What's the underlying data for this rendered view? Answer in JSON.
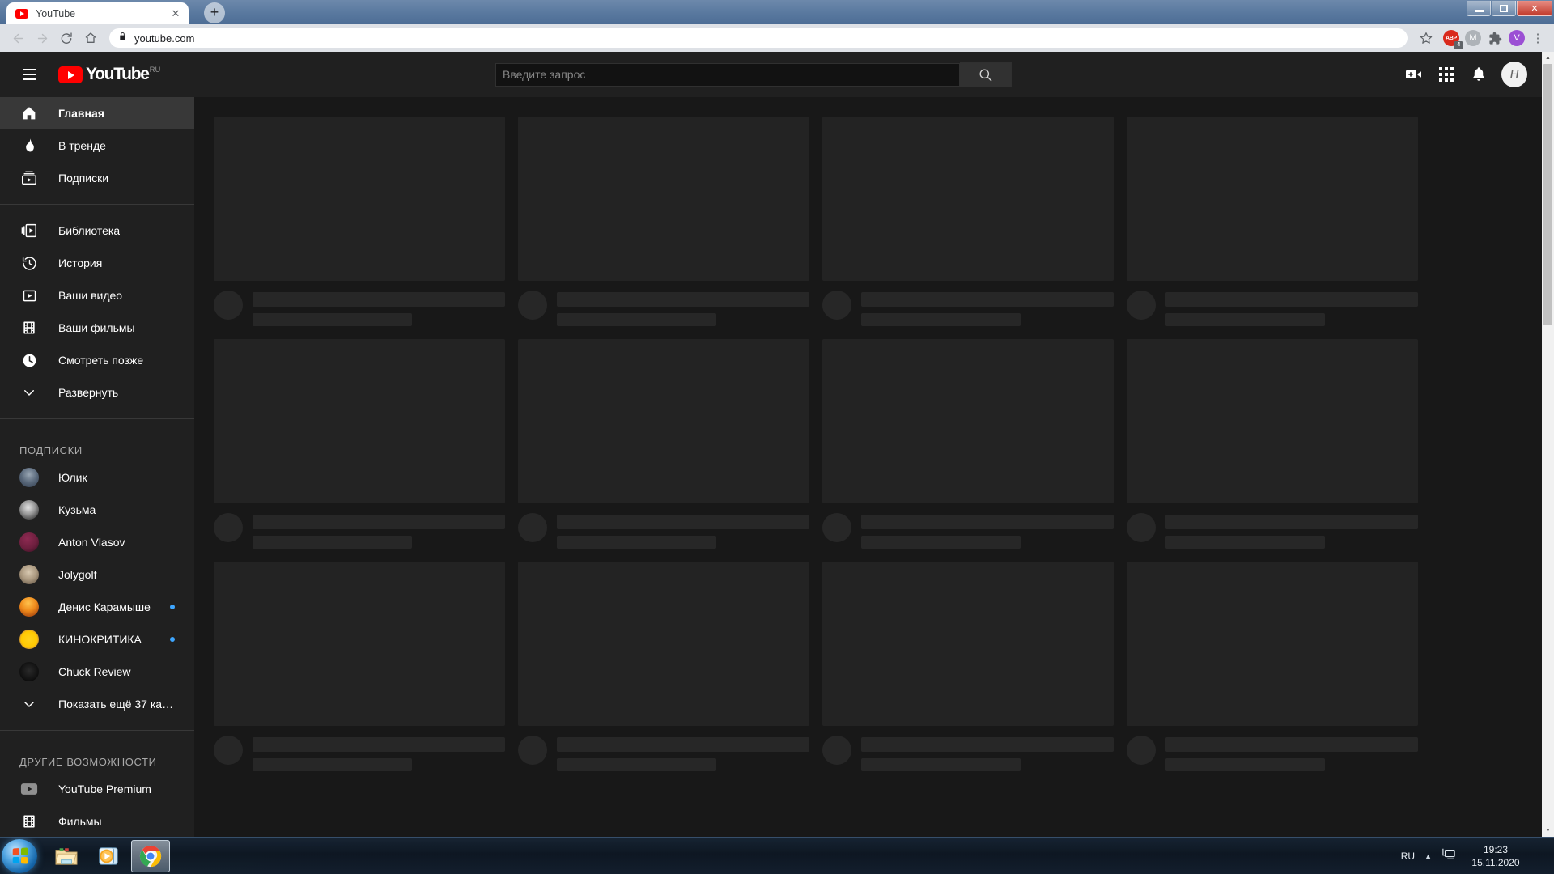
{
  "desktop": {
    "taskbar": {
      "start_label": "start-orb",
      "apps": [
        {
          "name": "explorer",
          "label": "Windows Explorer"
        },
        {
          "name": "media-player",
          "label": "Windows Media Player"
        },
        {
          "name": "chrome",
          "label": "Google Chrome",
          "active": true
        }
      ],
      "tray": {
        "language": "RU",
        "time": "19:23",
        "date": "15.11.2020"
      }
    }
  },
  "browser": {
    "tab": {
      "title": "YouTube",
      "close_label": "✕"
    },
    "new_tab_label": "+",
    "window_controls": {
      "minimize": "minimize",
      "maximize": "maximize",
      "close": "✕"
    },
    "toolbar": {
      "back": "←",
      "forward": "→",
      "reload": "↻",
      "home": "home-icon",
      "url": "youtube.com",
      "lock": "lock-icon",
      "bookmark": "☆",
      "extensions": [
        {
          "name": "adblock-plus",
          "label": "ABP",
          "badge": "4",
          "color": "#d9291c"
        },
        {
          "name": "extension-m",
          "label": "M",
          "color": "#aeb3b8"
        },
        {
          "name": "extensions-puzzle",
          "label": "puzzle",
          "color": "#5f6368"
        },
        {
          "name": "profile-v",
          "label": "V",
          "color": "#9b4fd4"
        }
      ],
      "menu": "⋮"
    }
  },
  "youtube": {
    "masthead": {
      "menu_label": "guide-toggle",
      "logo_word": "YouTube",
      "logo_country": "RU",
      "search_placeholder": "Введите запрос",
      "search_value": "",
      "search_button_label": "search-icon",
      "icons": [
        {
          "name": "create-video-icon",
          "label": "Создать"
        },
        {
          "name": "apps-grid-icon",
          "label": "Приложения YouTube"
        },
        {
          "name": "notifications-bell-icon",
          "label": "Уведомления"
        }
      ],
      "avatar_initial": "Н"
    },
    "guide": {
      "primary": [
        {
          "label": "Главная",
          "icon": "home-icon",
          "active": true
        },
        {
          "label": "В тренде",
          "icon": "trending-flame-icon",
          "active": false
        },
        {
          "label": "Подписки",
          "icon": "subscriptions-icon",
          "active": false
        }
      ],
      "library": [
        {
          "label": "Библиотека",
          "icon": "library-icon"
        },
        {
          "label": "История",
          "icon": "history-icon"
        },
        {
          "label": "Ваши видео",
          "icon": "your-videos-icon"
        },
        {
          "label": "Ваши фильмы",
          "icon": "film-icon"
        },
        {
          "label": "Смотреть позже",
          "icon": "watch-later-clock-icon"
        },
        {
          "label": "Развернуть",
          "icon": "chevron-down-icon"
        }
      ],
      "subscriptions_title": "ПОДПИСКИ",
      "subscriptions": [
        {
          "name": "Юлик",
          "new": false,
          "c1": "#9aa7b4",
          "c2": "#2f3b4c"
        },
        {
          "name": "Кузьма",
          "new": false,
          "c1": "#d8d8d8",
          "c2": "#1b1b1b"
        },
        {
          "name": "Anton Vlasov",
          "new": false,
          "c1": "#7d2348",
          "c2": "#3a0f22"
        },
        {
          "name": "Jolygolf",
          "new": false,
          "c1": "#cdbda4",
          "c2": "#6b5a48"
        },
        {
          "name": "Денис Карамышев",
          "new": true,
          "c1": "#f0a02a",
          "c2": "#8c2d0a"
        },
        {
          "name": "КИНОКРИТИКА",
          "new": true,
          "c1": "#ffd21e",
          "c2": "#6b21a8"
        },
        {
          "name": "Chuck Review",
          "new": false,
          "c1": "#1a1a1a",
          "c2": "#000000"
        }
      ],
      "show_more": {
        "label": "Показать ещё 37 ка…",
        "icon": "chevron-down-icon"
      },
      "other_title": "ДРУГИЕ ВОЗМОЖНОСТИ",
      "other": [
        {
          "label": "YouTube Premium",
          "icon": "youtube-premium-icon"
        },
        {
          "label": "Фильмы",
          "icon": "film-icon"
        }
      ]
    },
    "content": {
      "state": "loading-skeleton",
      "skeleton_cards": 12
    },
    "colors": {
      "brand_red": "#ff0000",
      "surface": "#202020",
      "background": "#181818",
      "skeleton": "#272727",
      "accent_blue": "#3ea6ff"
    }
  }
}
